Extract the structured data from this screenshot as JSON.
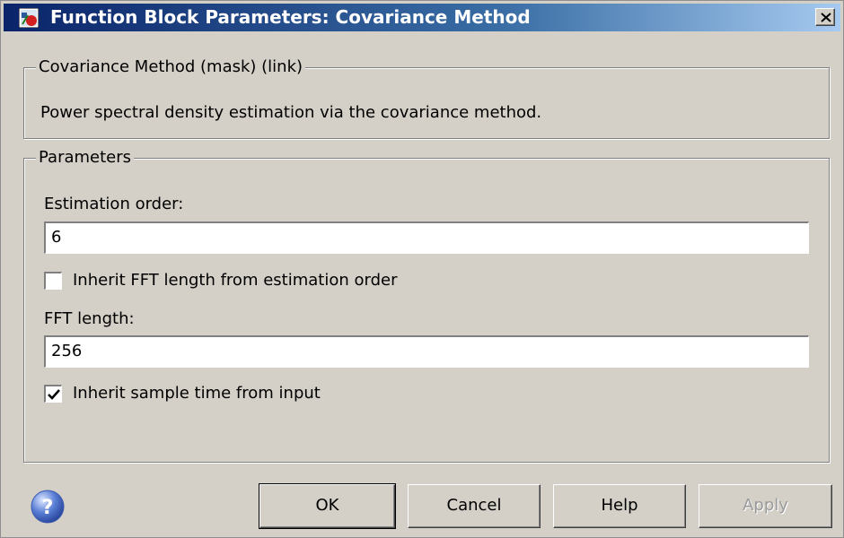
{
  "window": {
    "title": "Function Block Parameters: Covariance Method",
    "icon": "simulink-block-icon",
    "close_icon": "close-icon"
  },
  "description_group": {
    "legend": "Covariance Method (mask) (link)",
    "text": "Power spectral density estimation via the covariance method."
  },
  "parameters_group": {
    "legend": "Parameters",
    "estimation_order_label": "Estimation order:",
    "estimation_order_value": "6",
    "inherit_fft_label": "Inherit FFT length from estimation order",
    "inherit_fft_checked": false,
    "fft_length_label": "FFT length:",
    "fft_length_value": "256",
    "inherit_sample_time_label": "Inherit sample time from input",
    "inherit_sample_time_checked": true
  },
  "buttons": {
    "ok": "OK",
    "cancel": "Cancel",
    "help": "Help",
    "apply": "Apply",
    "apply_enabled": false
  },
  "help_icon": "question-mark-icon"
}
